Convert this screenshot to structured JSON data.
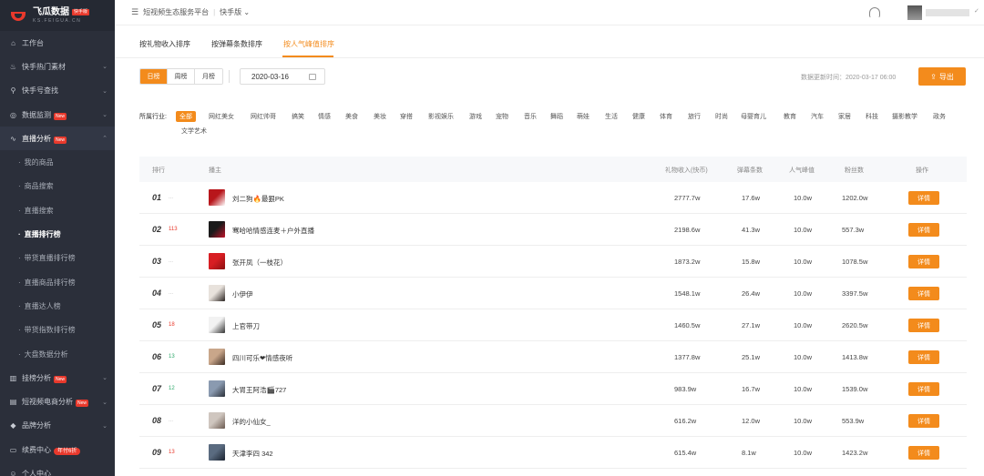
{
  "brand": {
    "name": "飞瓜数据",
    "badge": "快手版",
    "sub": "KS.FEIGUA.CN"
  },
  "sidebar": {
    "items": [
      {
        "label": "工作台",
        "icon": "home-icon",
        "glyph": "⌂"
      },
      {
        "label": "快手热门素材",
        "icon": "flame-icon",
        "glyph": "♨",
        "chev": "⌄"
      },
      {
        "label": "快手号查找",
        "icon": "search-icon",
        "glyph": "⚲",
        "chev": "⌄"
      },
      {
        "label": "数据监测",
        "icon": "monitor-icon",
        "glyph": "◎",
        "chev": "⌄",
        "badge": "New"
      },
      {
        "label": "直播分析",
        "icon": "live-icon",
        "glyph": "∿",
        "chev": "⌃",
        "badge": "New"
      }
    ],
    "sub_items": [
      "我的商品",
      "商品搜索",
      "直播搜索",
      "直播排行榜",
      "带货直播排行榜",
      "直播商品排行榜",
      "直播达人榜",
      "带货指数排行榜",
      "大盘数据分析"
    ],
    "bottom_items": [
      {
        "label": "挂榜分析",
        "icon": "bar-chart-icon",
        "glyph": "▥",
        "badge": "New",
        "chev": "⌄"
      },
      {
        "label": "短视频电商分析",
        "icon": "shop-icon",
        "glyph": "▤",
        "badge": "New",
        "chev": "⌄"
      },
      {
        "label": "品牌分析",
        "icon": "diamond-icon",
        "glyph": "◆",
        "chev": "⌄"
      },
      {
        "label": "续费中心",
        "icon": "card-icon",
        "glyph": "▭",
        "promo": "年付6折"
      },
      {
        "label": "个人中心",
        "icon": "user-icon",
        "glyph": "☺"
      }
    ]
  },
  "header": {
    "platform": "短视频生态服务平台",
    "version": "快手版"
  },
  "tabs": [
    "按礼物收入排序",
    "按弹幕条数排序",
    "按人气峰值排序"
  ],
  "period": [
    "日榜",
    "周榜",
    "月榜"
  ],
  "date": "2020-03-16",
  "update_label": "数据更新时间：",
  "update_time": "2020-03-17 06:00",
  "export_label": "导出",
  "industry_label": "所属行业:",
  "industries": [
    "全部",
    "网红美女",
    "网红帅哥",
    "搞笑",
    "情感",
    "美食",
    "美妆",
    "穿搭",
    "影视娱乐",
    "游戏",
    "宠物",
    "音乐",
    "舞蹈",
    "萌娃",
    "生活",
    "健康",
    "体育",
    "旅行",
    "时尚",
    "母婴育儿",
    "教育",
    "汽车",
    "家居",
    "科技",
    "摄影教学",
    "政务",
    "文学艺术"
  ],
  "columns": [
    "排行",
    "播主",
    "礼物收入(快币)",
    "弹幕条数",
    "人气峰值",
    "粉丝数",
    "操作"
  ],
  "rows": [
    {
      "rank": "01",
      "chg": "...",
      "dir": "none",
      "name": "刘二狗🔥最狠PK",
      "gift": "2777.7w",
      "danmu": "17.6w",
      "peak": "10.0w",
      "fans": "1202.0w",
      "av": [
        "#b8161b",
        "#ffffff"
      ]
    },
    {
      "rank": "02",
      "chg": "113",
      "dir": "up",
      "name": "骞哈哈情感连麦＋户外直播",
      "gift": "2198.6w",
      "danmu": "41.3w",
      "peak": "10.0w",
      "fans": "557.3w",
      "av": [
        "#1a1a1a",
        "#c0142a"
      ]
    },
    {
      "rank": "03",
      "chg": "...",
      "dir": "none",
      "name": "张开凤（一枝花）",
      "gift": "1873.2w",
      "danmu": "15.8w",
      "peak": "10.0w",
      "fans": "1078.5w",
      "av": [
        "#d81e23",
        "#8a1010"
      ]
    },
    {
      "rank": "04",
      "chg": "...",
      "dir": "none",
      "name": "小伊伊",
      "gift": "1548.1w",
      "danmu": "26.4w",
      "peak": "10.0w",
      "fans": "3397.5w",
      "av": [
        "#e8e2dc",
        "#2a2320"
      ]
    },
    {
      "rank": "05",
      "chg": "18",
      "dir": "up",
      "name": "上官带刀",
      "gift": "1460.5w",
      "danmu": "27.1w",
      "peak": "10.0w",
      "fans": "2620.5w",
      "av": [
        "#f2f2f2",
        "#333333"
      ]
    },
    {
      "rank": "06",
      "chg": "13",
      "dir": "down",
      "name": "四川可乐❤情感夜听",
      "gift": "1377.8w",
      "danmu": "25.1w",
      "peak": "10.0w",
      "fans": "1413.8w",
      "av": [
        "#c9a68a",
        "#3b2b22"
      ]
    },
    {
      "rank": "07",
      "chg": "12",
      "dir": "down",
      "name": "大胃王阿浩🎬727",
      "gift": "983.9w",
      "danmu": "16.7w",
      "peak": "10.0w",
      "fans": "1539.0w",
      "av": [
        "#8a9ab0",
        "#2a2f38"
      ]
    },
    {
      "rank": "08",
      "chg": "...",
      "dir": "none",
      "name": "洋的小仙女_",
      "gift": "616.2w",
      "danmu": "12.0w",
      "peak": "10.0w",
      "fans": "553.9w",
      "av": [
        "#cfc6bf",
        "#6b5a50"
      ]
    },
    {
      "rank": "09",
      "chg": "13",
      "dir": "up",
      "name": "天津李四 342",
      "gift": "615.4w",
      "danmu": "8.1w",
      "peak": "10.0w",
      "fans": "1423.2w",
      "av": [
        "#5a6b80",
        "#1a2230"
      ]
    }
  ],
  "detail_label": "详情"
}
